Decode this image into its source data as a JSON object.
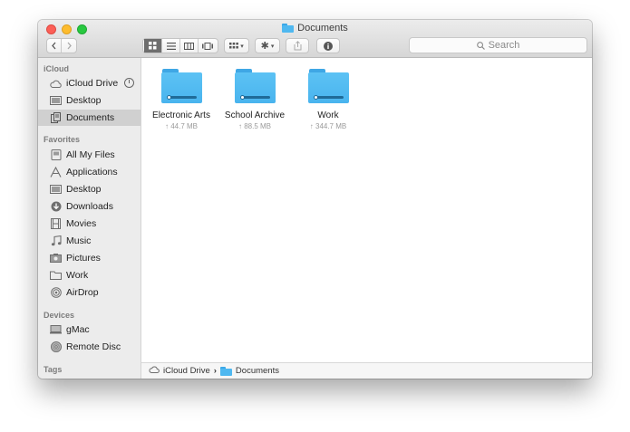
{
  "window": {
    "title": "Documents"
  },
  "toolbar": {
    "back_icon": "chevron-left",
    "forward_icon": "chevron-right",
    "view_modes": [
      "icon-view",
      "list-view",
      "column-view",
      "gallery-view"
    ],
    "active_view": "icon-view",
    "search_placeholder": "Search"
  },
  "sidebar": {
    "sections": [
      {
        "header": "iCloud",
        "items": [
          {
            "label": "iCloud Drive",
            "icon": "cloud-icon"
          },
          {
            "label": "Desktop",
            "icon": "desktop-icon"
          },
          {
            "label": "Documents",
            "icon": "documents-icon",
            "selected": true
          }
        ]
      },
      {
        "header": "Favorites",
        "items": [
          {
            "label": "All My Files",
            "icon": "all-files-icon"
          },
          {
            "label": "Applications",
            "icon": "applications-icon"
          },
          {
            "label": "Desktop",
            "icon": "desktop-icon"
          },
          {
            "label": "Downloads",
            "icon": "downloads-icon"
          },
          {
            "label": "Movies",
            "icon": "movies-icon"
          },
          {
            "label": "Music",
            "icon": "music-icon"
          },
          {
            "label": "Pictures",
            "icon": "pictures-icon"
          },
          {
            "label": "Work",
            "icon": "folder-icon"
          },
          {
            "label": "AirDrop",
            "icon": "airdrop-icon"
          }
        ]
      },
      {
        "header": "Devices",
        "items": [
          {
            "label": "gMac",
            "icon": "computer-icon"
          },
          {
            "label": "Remote Disc",
            "icon": "disc-icon"
          }
        ]
      },
      {
        "header": "Tags",
        "items": []
      }
    ]
  },
  "files": [
    {
      "name": "Electronic Arts",
      "size": "↑ 44.7 MB"
    },
    {
      "name": "School Archive",
      "size": "↑ 88.5 MB"
    },
    {
      "name": "Work",
      "size": "↑ 344.7 MB"
    }
  ],
  "pathbar": {
    "root": "iCloud Drive",
    "separator": "›",
    "current": "Documents"
  }
}
